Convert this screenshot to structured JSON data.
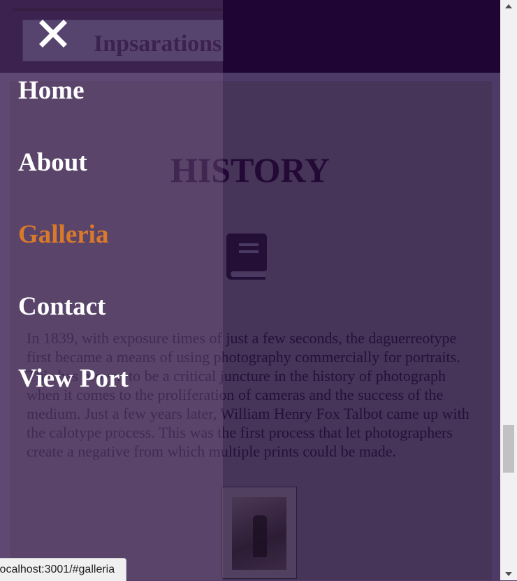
{
  "header": {
    "inspirations_label": "Inpsarations"
  },
  "main": {
    "title": "HISTORY",
    "body": "In 1839, with exposure times of just a few seconds, the daguerreotype first became a means of using photography commercially for portraits. This has proven to be a critical juncture in the history of photograph when it comes to the proliferation of cameras and the success of the medium. Just a few years later, William Henry Fox Talbot came up with the calotype process. This was the first process that let photographers create a negative from which multiple prints could be made.",
    "icon": "book-icon"
  },
  "menu": {
    "close_icon": "close-icon",
    "items": [
      {
        "label": "Home"
      },
      {
        "label": "About"
      },
      {
        "label": "Galleria"
      },
      {
        "label": "Contact"
      },
      {
        "label": "View Port"
      }
    ],
    "active_color": "#d97a2a"
  },
  "status": {
    "url": "localhost:3001/#galleria"
  }
}
